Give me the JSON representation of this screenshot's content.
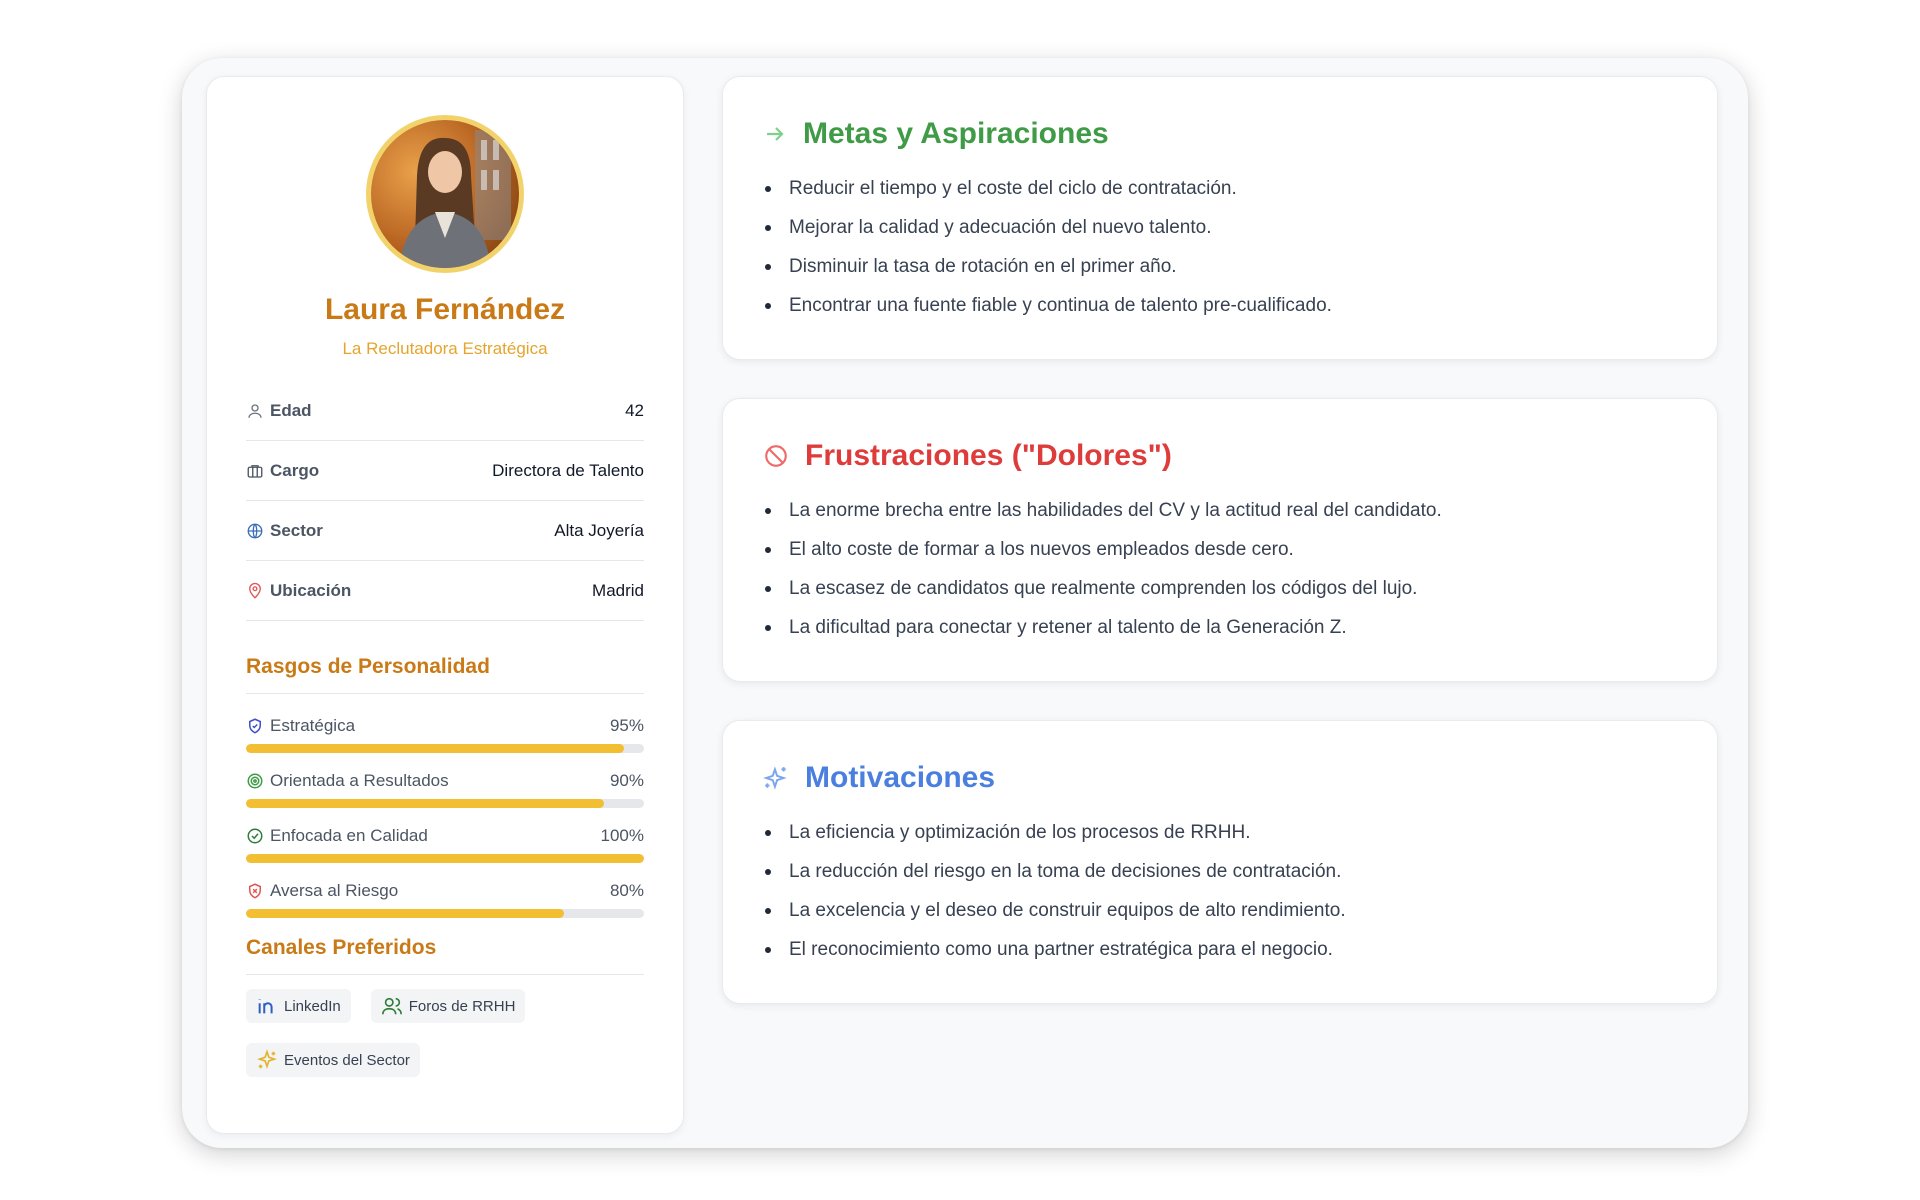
{
  "profile": {
    "name": "Laura Fernández",
    "subtitle": "La Reclutadora Estratégica",
    "info": [
      {
        "label": "Edad",
        "value": "42"
      },
      {
        "label": "Cargo",
        "value": "Directora de Talento"
      },
      {
        "label": "Sector",
        "value": "Alta Joyería"
      },
      {
        "label": "Ubicación",
        "value": "Madrid"
      }
    ],
    "traits_title": "Rasgos de Personalidad",
    "traits": [
      {
        "label": "Estratégica",
        "value": "95%",
        "level": 95
      },
      {
        "label": "Orientada a Resultados",
        "value": "90%",
        "level": 90
      },
      {
        "label": "Enfocada en Calidad",
        "value": "100%",
        "level": 100
      },
      {
        "label": "Aversa al Riesgo",
        "value": "80%",
        "level": 80
      }
    ],
    "channels_title": "Canales Preferidos",
    "channels": [
      {
        "label": "LinkedIn",
        "icon": "linkedin-icon"
      },
      {
        "label": "Foros de RRHH",
        "icon": "users-icon"
      },
      {
        "label": "Eventos del Sector",
        "icon": "sparkles-icon"
      }
    ]
  },
  "goals": {
    "title": "Metas y Aspiraciones",
    "icon": "arrow-right-icon",
    "color": "#3f9b46",
    "items": [
      "Reducir el tiempo y el coste del ciclo de contratación.",
      "Mejorar la calidad y adecuación del nuevo talento.",
      "Disminuir la tasa de rotación en el primer año.",
      "Encontrar una fuente fiable y continua de talento pre-cualificado."
    ]
  },
  "frustrations": {
    "title": "Frustraciones (\"Dolores\")",
    "icon": "ban-icon",
    "color": "#de3b3b",
    "items": [
      "La enorme brecha entre las habilidades del CV y la actitud real del candidato.",
      "El alto coste de formar a los nuevos empleados desde cero.",
      "La escasez de candidatos que realmente comprenden los códigos del lujo.",
      "La dificultad para conectar y retener al talento de la Generación Z."
    ]
  },
  "motivations": {
    "title": "Motivaciones",
    "icon": "sparkles-icon",
    "color": "#4a7fe0",
    "items": [
      "La eficiencia y optimización de los procesos de RRHH.",
      "La reducción del riesgo en la toma de decisiones de contratación.",
      "La excelencia y el deseo de construir equipos de alto rendimiento.",
      "El reconocimiento como una partner estratégica para el negocio."
    ]
  },
  "colors": {
    "accent": "#c97a16",
    "bar": "#f2bf33",
    "avatar_ring": "#f2d36b"
  }
}
